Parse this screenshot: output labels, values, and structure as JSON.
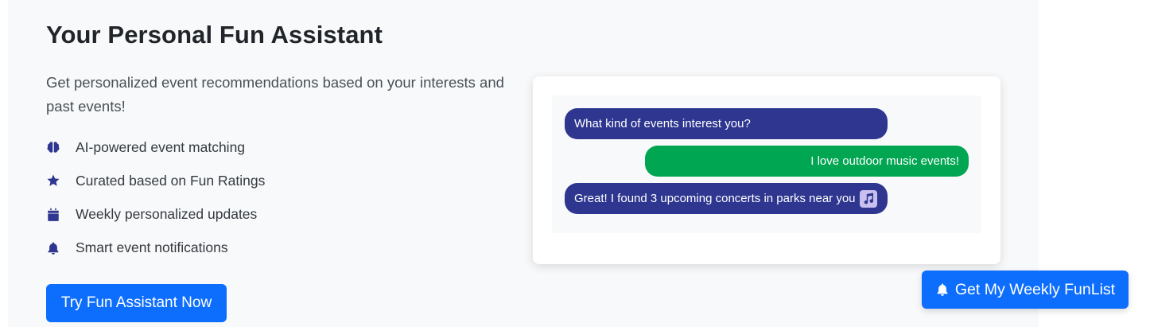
{
  "hero": {
    "title": "Your Personal Fun Assistant",
    "lead": "Get personalized event recommendations based on your interests and past events!",
    "features": [
      {
        "icon": "brain-icon",
        "label": "AI-powered event matching"
      },
      {
        "icon": "star-icon",
        "label": "Curated based on Fun Ratings"
      },
      {
        "icon": "calendar-icon",
        "label": "Weekly personalized updates"
      },
      {
        "icon": "bell-icon",
        "label": "Smart event notifications"
      }
    ],
    "cta_label": "Try Fun Assistant Now"
  },
  "chat": {
    "messages": [
      {
        "role": "assistant",
        "text": "What kind of events interest you?"
      },
      {
        "role": "user",
        "text": "I love outdoor music events!"
      },
      {
        "role": "assistant",
        "text": "Great! I found 3 upcoming concerts in parks near you",
        "emoji": "musical-notes-icon"
      }
    ]
  },
  "floating_button": {
    "icon": "bell-icon",
    "label": "Get My Weekly FunList"
  },
  "colors": {
    "primary": "#0d6efd",
    "bot_bubble": "#2e3690",
    "user_bubble": "#00a651",
    "section_bg": "#f8f9fa"
  }
}
